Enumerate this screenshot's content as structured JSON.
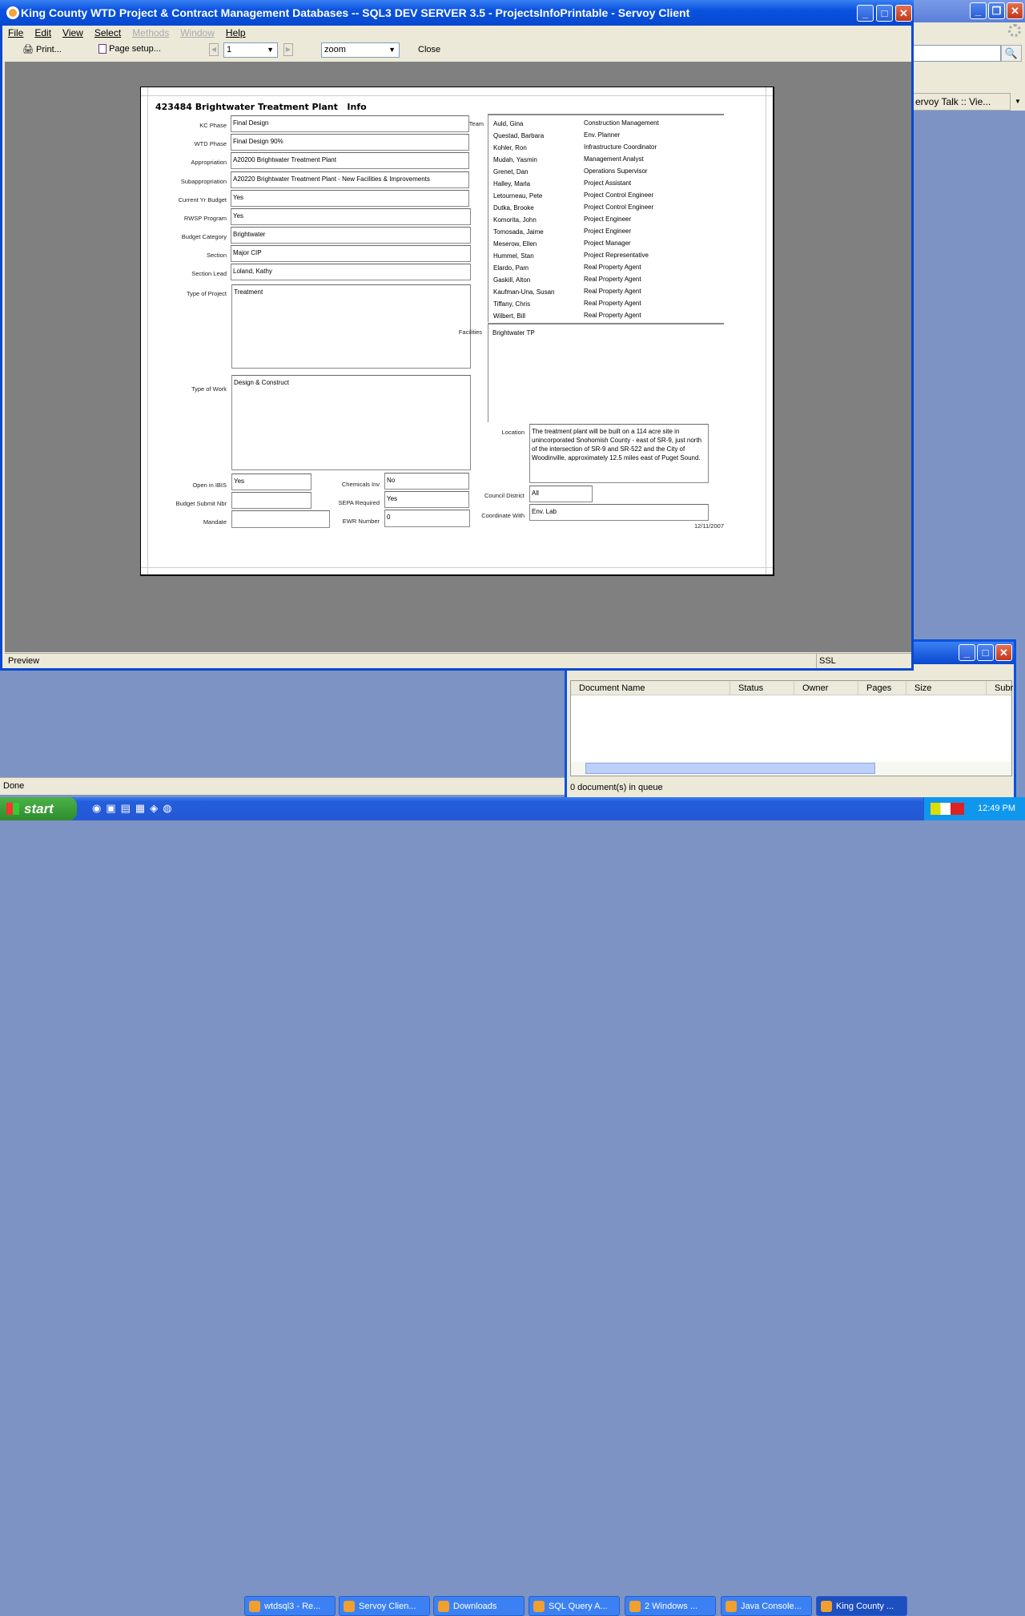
{
  "main_window": {
    "title": "King County WTD Project & Contract Management Databases -- SQL3 DEV SERVER 3.5 - ProjectsInfoPrintable - Servoy Client",
    "menu": [
      "File",
      "Edit",
      "View",
      "Select",
      "Methods",
      "Window",
      "Help"
    ],
    "toolbar": {
      "print": "Print...",
      "page_setup": "Page setup...",
      "page": "1",
      "zoom": "zoom",
      "close": "Close"
    },
    "status": {
      "left": "Preview",
      "ssl": "SSL"
    }
  },
  "report": {
    "heading": "423484 Brightwater Treatment Plant   Info",
    "fields": [
      {
        "label": "KC Phase",
        "value": "Final Design"
      },
      {
        "label": "WTD Phase",
        "value": "Final Design 90%"
      },
      {
        "label": "Appropriation",
        "value": "A20200    Brightwater Treatment Plant"
      },
      {
        "label": "Subappropriation",
        "value": "A20220  Brightwater Treatment Plant - New Facilities & Improvements"
      },
      {
        "label": "Current  Yr Budget",
        "value": "Yes"
      },
      {
        "label": "RWSP Program",
        "value": "Yes"
      },
      {
        "label": "Budget Category",
        "value": "Brightwater"
      },
      {
        "label": "Section",
        "value": "Major CIP"
      },
      {
        "label": "Section Lead",
        "value": "Loland, Kathy"
      }
    ],
    "type_of_project": {
      "label": "Type of Project",
      "value": "Treatment"
    },
    "type_of_work": {
      "label": "Type of Work",
      "value": "Design & Construct"
    },
    "open_in_ibis": {
      "label": "Open in IBIS",
      "value": "Yes"
    },
    "budget_submit_nbr": {
      "label": "Budget Submit Nbr",
      "value": ""
    },
    "mandate": {
      "label": "Mandate",
      "value": ""
    },
    "chemicals_inv": {
      "label": "Chemicals Inv",
      "value": "No"
    },
    "sepa_required": {
      "label": "SEPA Required",
      "value": "Yes"
    },
    "ewr_number": {
      "label": "EWR Number",
      "value": "0"
    },
    "team_label": "Team",
    "team": [
      [
        "Auld, Gina",
        "Construction Management"
      ],
      [
        "Questad, Barbara",
        "Env. Planner"
      ],
      [
        "Kohler, Ron",
        "Infrastructure Coordinator"
      ],
      [
        "Mudah, Yasmin",
        "Management Analyst"
      ],
      [
        "Grenet, Dan",
        "Operations Supervisor"
      ],
      [
        "Halley, Marla",
        "Project Assistant"
      ],
      [
        "Letourneau, Pete",
        "Project Control Engineer"
      ],
      [
        "Dutka, Brooke",
        "Project Control Engineer"
      ],
      [
        "Komorita, John",
        "Project Engineer"
      ],
      [
        "Tomosada, Jaime",
        "Project Engineer"
      ],
      [
        "Meserow, Ellen",
        "Project Manager"
      ],
      [
        "Hummel, Stan",
        "Project Representative"
      ],
      [
        "Elardo, Pam",
        "Real Property Agent"
      ],
      [
        "Gaskill, Alton",
        "Real Property Agent"
      ],
      [
        "Kaufman-Una, Susan",
        "Real Property Agent"
      ],
      [
        "Tiffany, Chris",
        "Real Property Agent"
      ],
      [
        "Wilbert, Bill",
        "Real Property Agent"
      ]
    ],
    "facilities": {
      "label": "Facilities",
      "value": "Brightwater TP"
    },
    "location": {
      "label": "Location",
      "value": "The treatment plant will be built on a 114 acre site in unincorporated Snohomish County - east of SR-9, just north of the intersection of SR-9 and SR-522 and the City of Woodinville, approximately 12.5 miles east of Puget Sound."
    },
    "council_district": {
      "label": "Council District",
      "value": "All"
    },
    "coordinate_with": {
      "label": "Coordinate With",
      "value": "Env. Lab"
    },
    "date": "12/11/2007"
  },
  "browser": {
    "tab": "ervoy Talk :: Vie...",
    "status": "Done"
  },
  "print_queue": {
    "columns": [
      "Document Name",
      "Status",
      "Owner",
      "Pages",
      "Size",
      "Subr"
    ],
    "status": "0 document(s) in queue"
  },
  "taskbar": {
    "start": "start",
    "items": [
      "wtdsql3 - Re...",
      "Servoy Clien...",
      "Downloads",
      "SQL Query A...",
      "2 Windows ...",
      "Java Console...",
      "King County ..."
    ],
    "clock": "12:49 PM"
  }
}
